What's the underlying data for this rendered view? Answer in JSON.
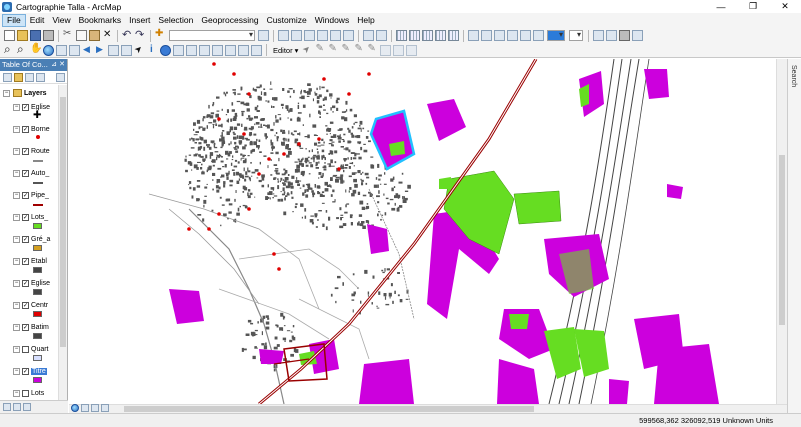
{
  "window": {
    "title": "Cartographie Talla - ArcMap",
    "min": "—",
    "max": "❐",
    "close": "✕"
  },
  "menu": [
    "File",
    "Edit",
    "View",
    "Bookmarks",
    "Insert",
    "Selection",
    "Geoprocessing",
    "Customize",
    "Windows",
    "Help"
  ],
  "toolbar": {
    "editor_label": "Editor ▾"
  },
  "toc": {
    "title": "Table Of Co...",
    "pin": "⊿",
    "close": "✕",
    "root": "Layers",
    "layers": [
      {
        "name": "Eglise",
        "checked": true,
        "symbol": "cross",
        "color": "#000000"
      },
      {
        "name": "Borne",
        "checked": true,
        "symbol": "dot",
        "color": "#e00000"
      },
      {
        "name": "Route",
        "checked": true,
        "symbol": "line",
        "color": "#888888"
      },
      {
        "name": "Auto_",
        "checked": true,
        "symbol": "line",
        "color": "#555555"
      },
      {
        "name": "Pipe_",
        "checked": true,
        "symbol": "line",
        "color": "#a00000"
      },
      {
        "name": "Lots_",
        "checked": true,
        "symbol": "fill",
        "color": "#66dd22"
      },
      {
        "name": "Gré_a",
        "checked": true,
        "symbol": "fill",
        "color": "#d4a020"
      },
      {
        "name": "Etabl",
        "checked": true,
        "symbol": "fill",
        "color": "#444444"
      },
      {
        "name": "Eglise",
        "checked": true,
        "symbol": "fill",
        "color": "#444444"
      },
      {
        "name": "Centr",
        "checked": true,
        "symbol": "fill",
        "color": "#e00000"
      },
      {
        "name": "Batim",
        "checked": true,
        "symbol": "fill",
        "color": "#444444"
      },
      {
        "name": "Quart",
        "checked": false,
        "symbol": "fill",
        "color": "#d8e0ff"
      },
      {
        "name": "Titre",
        "checked": true,
        "symbol": "fill",
        "color": "#cc00dd",
        "selected": true
      },
      {
        "name": "Lots",
        "checked": false,
        "symbol": "none",
        "color": "#ffffff"
      }
    ]
  },
  "map": {
    "colors": {
      "magenta": "#cc00dd",
      "green": "#66dd22",
      "building": "#555555",
      "pipe": "#9a0000",
      "highlight": "#22c0ff"
    }
  },
  "search_tab": "Search",
  "status": {
    "coords": "599568,362  326092,519 Unknown Units"
  }
}
